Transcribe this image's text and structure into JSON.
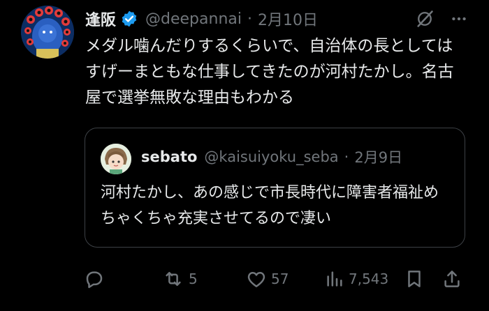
{
  "tweet": {
    "author_name": "逢阪",
    "handle": "@deepannai",
    "separator": "·",
    "date": "2月10日",
    "text": "メダル噛んだりするくらいで、自治体の長としてはすげーまともな仕事してきたのが河村たかし。名古屋で選挙無敗な理由もわかる",
    "icons": [
      "verified-badge-icon",
      "grok-icon",
      "more-icon"
    ]
  },
  "quoted": {
    "author_name": "sebato",
    "handle": "@kaisuiyoku_seba",
    "separator": "·",
    "date": "2月9日",
    "text": "河村たかし、あの感じで市長時代に障害者福祉めちゃくちゃ充実させてるので凄い"
  },
  "actions": {
    "reply_count": "",
    "retweet_count": "5",
    "like_count": "57",
    "views_count": "7,543"
  },
  "colors": {
    "background": "#000000",
    "text": "#e7e9ea",
    "muted": "#71767b",
    "verified": "#1d9bf0",
    "border": "#3d4146"
  }
}
